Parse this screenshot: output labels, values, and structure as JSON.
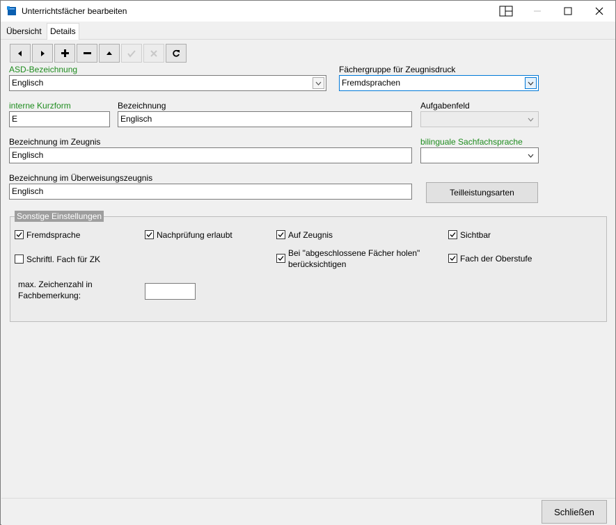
{
  "window": {
    "title": "Unterrichtsfächer bearbeiten"
  },
  "tabs": [
    {
      "label": "Übersicht",
      "active": false
    },
    {
      "label": "Details",
      "active": true
    }
  ],
  "toolbar": {
    "buttons": [
      "prev-icon",
      "next-icon",
      "plus-icon",
      "minus-icon",
      "up-icon",
      "check-icon",
      "cancel-icon",
      "refresh-icon"
    ]
  },
  "form": {
    "asd_label": "ASD-Bezeichnung",
    "asd_value": "Englisch",
    "faechergruppe_label": "Fächergruppe für Zeugnisdruck",
    "faechergruppe_value": "Fremdsprachen",
    "kurzform_label": "interne Kurzform",
    "kurzform_value": "E",
    "bezeichnung_label": "Bezeichnung",
    "bezeichnung_value": "Englisch",
    "aufgabenfeld_label": "Aufgabenfeld",
    "aufgabenfeld_value": "",
    "zeugnis_label": "Bezeichnung im Zeugnis",
    "zeugnis_value": "Englisch",
    "bilingual_label": "bilinguale Sachfachsprache",
    "bilingual_value": "",
    "ueberweisung_label": "Bezeichnung im Überweisungszeugnis",
    "ueberweisung_value": "Englisch",
    "teilleistung_button": "Teilleistungsarten"
  },
  "sonstige": {
    "title": "Sonstige Einstellungen",
    "checkboxes": [
      {
        "label": "Fremdsprache",
        "checked": true
      },
      {
        "label": "Nachprüfung erlaubt",
        "checked": true
      },
      {
        "label": "Auf Zeugnis",
        "checked": true
      },
      {
        "label": "Sichtbar",
        "checked": true
      },
      {
        "label": "Schriftl. Fach für ZK",
        "checked": false
      },
      {
        "label": "Bei \"abgeschlossene Fächer holen\"",
        "label2": "berücksichtigen",
        "checked": true
      },
      {
        "label": "Fach der Oberstufe",
        "checked": true
      }
    ],
    "max_label_line1": "max. Zeichenzahl in",
    "max_label_line2": "Fachbemerkung:",
    "max_value": ""
  },
  "footer": {
    "close_button": "Schließen"
  },
  "colors": {
    "green_label": "#1e8c1e",
    "focus": "#0078d7"
  }
}
